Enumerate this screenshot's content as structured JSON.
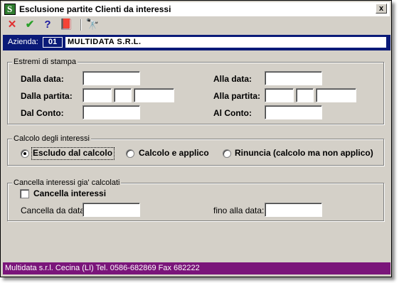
{
  "window": {
    "title": "Esclusione partite Clienti da interessi",
    "close_label": "x"
  },
  "toolbar": {
    "items": [
      {
        "icon": "cancel-x-icon",
        "glyph": "✕",
        "color": "#e03030"
      },
      {
        "icon": "confirm-check-icon",
        "glyph": "✔",
        "color": "#2aa02a"
      },
      {
        "icon": "help-question-icon",
        "glyph": "?",
        "color": "#1a1aa0"
      },
      {
        "icon": "book-icon",
        "glyph": "📕",
        "color": "#8a1a8a"
      },
      {
        "icon": "binoculars-icon",
        "glyph": "🔭",
        "color": "#606060"
      }
    ]
  },
  "azienda": {
    "label": "Azienda:",
    "code": "01",
    "name": "MULTIDATA S.R.L."
  },
  "estremi": {
    "legend": "Estremi di stampa",
    "dalla_data": "Dalla data:",
    "alla_data": "Alla data:",
    "dalla_partita": "Dalla partita:",
    "alla_partita": "Alla partita:",
    "dal_conto": "Dal Conto:",
    "al_conto": "Al Conto:"
  },
  "calcolo": {
    "legend": "Calcolo degli interessi",
    "options": [
      "Escludo dal calcolo",
      "Calcolo e applico",
      "Rinuncia (calcolo ma non applico)"
    ],
    "selected": "Escludo dal calcolo"
  },
  "cancella": {
    "legend": "Cancella interessi gia' calcolati",
    "checkbox_label": "Cancella interessi",
    "checked": false,
    "da_data": "Cancella da data:",
    "fino_data": "fino alla data:"
  },
  "status": {
    "text": "Multidata s.r.l. Cecina (LI) Tel. 0586-682869  Fax 682222"
  }
}
